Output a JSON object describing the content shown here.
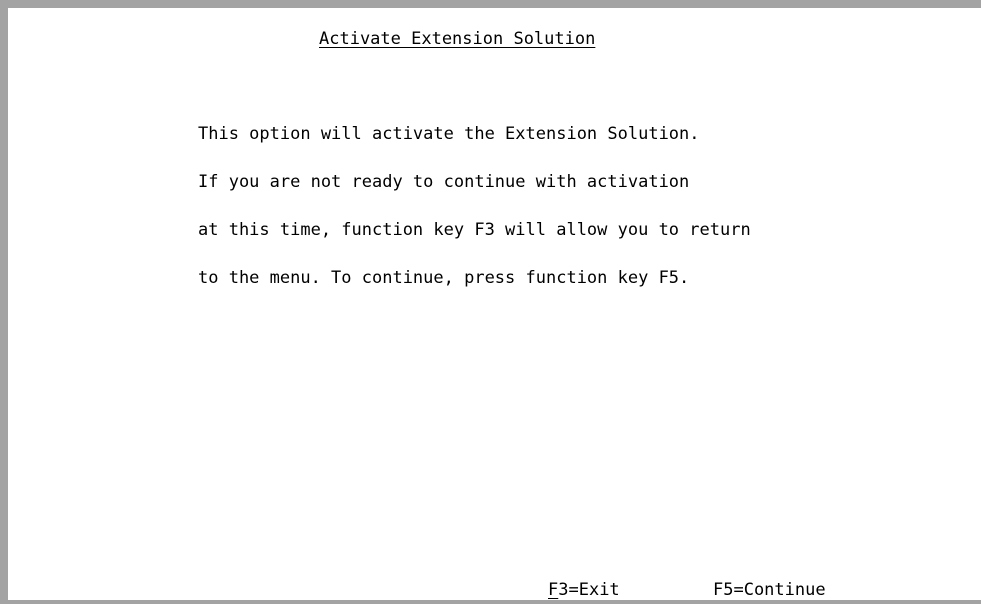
{
  "screen": {
    "title": "Activate Extension Solution",
    "message_lines": [
      "This option will activate the Extension Solution.",
      "If you are not ready to continue with activation",
      "at this time, function key F3 will allow you to return",
      "to the menu. To continue, press function key F5."
    ]
  },
  "function_keys": {
    "exit": {
      "hotkey": "F",
      "rest": "3=Exit"
    },
    "continue": {
      "label": "F5=Continue"
    }
  },
  "colors": {
    "background": "#ffffff",
    "text": "#000000",
    "frame": "#a3a3a3"
  }
}
